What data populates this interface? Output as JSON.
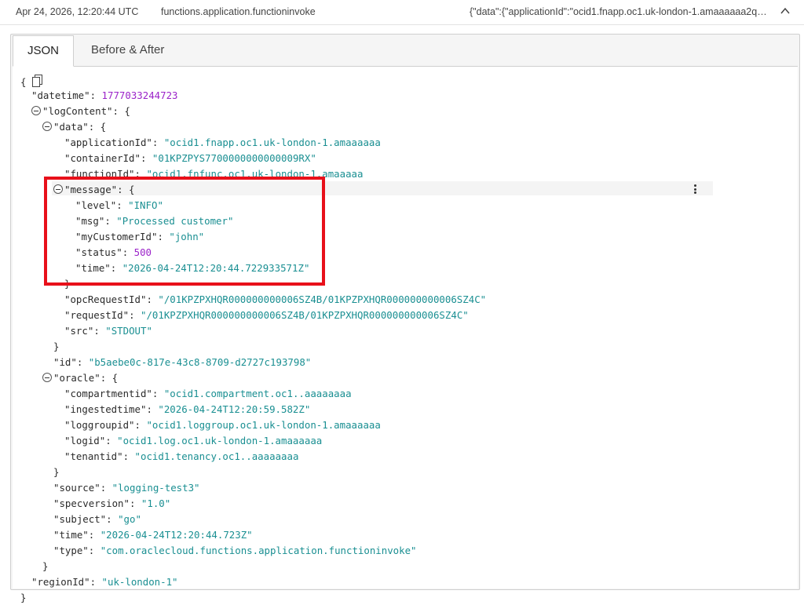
{
  "header": {
    "timestamp": "Apr 24, 2026, 12:20:44 UTC",
    "event_type": "functions.application.functioninvoke",
    "payload_preview": "{\"data\":{\"applicationId\":\"ocid1.fnapp.oc1.uk-london-1.amaaaaaa2qr…",
    "collapse_icon": "chevron-up-icon"
  },
  "tabs": [
    {
      "label": "JSON",
      "active": true
    },
    {
      "label": "Before & After",
      "active": false
    }
  ],
  "json": {
    "open_brace": "{",
    "datetime_key": "\"datetime\"",
    "datetime_val": "1777033244723",
    "logContent_key": "\"logContent\"",
    "data_key": "\"data\"",
    "applicationId_key": "\"applicationId\"",
    "applicationId_val": "\"ocid1.fnapp.oc1.uk-london-1.amaaaaaa",
    "containerId_key": "\"containerId\"",
    "containerId_val": "\"01KPZPYS7700000000000009RX\"",
    "functionId_key": "\"functionId\"",
    "functionId_val": "\"ocid1.fnfunc.oc1.uk-london-1.amaaaaa",
    "message_key": "\"message\"",
    "level_key": "\"level\"",
    "level_val": "\"INFO\"",
    "msg_key": "\"msg\"",
    "msg_val": "\"Processed customer\"",
    "myCustomerId_key": "\"myCustomerId\"",
    "myCustomerId_val": "\"john\"",
    "status_key": "\"status\"",
    "status_val": "500",
    "time_key": "\"time\"",
    "time_val": "\"2026-04-24T12:20:44.722933571Z\"",
    "opcRequestId_key": "\"opcRequestId\"",
    "opcRequestId_val": "\"/01KPZPXHQR000000000006SZ4B/01KPZPXHQR000000000006SZ4C\"",
    "requestId_key": "\"requestId\"",
    "requestId_val": "\"/01KPZPXHQR000000000006SZ4B/01KPZPXHQR000000000006SZ4C\"",
    "src_key": "\"src\"",
    "src_val": "\"STDOUT\"",
    "id_key": "\"id\"",
    "id_val": "\"b5aebe0c-817e-43c8-8709-d2727c193798\"",
    "oracle_key": "\"oracle\"",
    "compartmentid_key": "\"compartmentid\"",
    "compartmentid_val": "\"ocid1.compartment.oc1..aaaaaaaa",
    "ingestedtime_key": "\"ingestedtime\"",
    "ingestedtime_val": "\"2026-04-24T12:20:59.582Z\"",
    "loggroupid_key": "\"loggroupid\"",
    "loggroupid_val": "\"ocid1.loggroup.oc1.uk-london-1.amaaaaaa",
    "logid_key": "\"logid\"",
    "logid_val": "\"ocid1.log.oc1.uk-london-1.amaaaaaa",
    "tenantid_key": "\"tenantid\"",
    "tenantid_val": "\"ocid1.tenancy.oc1..aaaaaaaa",
    "source_key": "\"source\"",
    "source_val": "\"logging-test3\"",
    "specversion_key": "\"specversion\"",
    "specversion_val": "\"1.0\"",
    "subject_key": "\"subject\"",
    "subject_val": "\"go\"",
    "time2_key": "\"time\"",
    "time2_val": "\"2026-04-24T12:20:44.723Z\"",
    "type_key": "\"type\"",
    "type_val": "\"com.oraclecloud.functions.application.functioninvoke\"",
    "regionId_key": "\"regionId\"",
    "regionId_val": "\"uk-london-1\"",
    "close_brace": "}"
  },
  "colors": {
    "string": "#1a8f92",
    "number": "#9b23c9",
    "highlight_box": "#e8101a"
  }
}
